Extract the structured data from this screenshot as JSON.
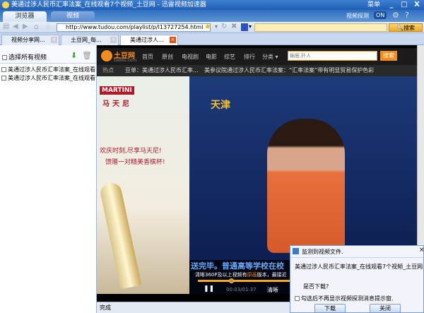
{
  "window": {
    "title": "美通过涉人民币汇率法案_在线观看7个视频_土豆网 - 迅雷视频加速器",
    "menu": "菜单",
    "min": "_",
    "max": "□",
    "close": "X"
  },
  "main_tabs": [
    {
      "label": "浏览器"
    },
    {
      "label": "视频"
    }
  ],
  "detect": {
    "label": "视频探测",
    "toggle": "ON"
  },
  "address": {
    "url": "http://www.tudou.com/playlist/p/l13727254.html",
    "search_button": "搜索",
    "search_value": ""
  },
  "browser_tabs": [
    {
      "label": "视频分享网..."
    },
    {
      "label": "土豆网_每..."
    },
    {
      "label": "美通过涉人..."
    }
  ],
  "left_panel": {
    "select_all": "选择所有视频",
    "items": [
      "美通过涉人民币汇率法案_在线观看7",
      "美通过涉人民币汇率法案_在线观看7"
    ]
  },
  "tudou": {
    "logo": "土豆网",
    "logo_sub": "tudou.com",
    "nav": [
      "首页",
      "原创",
      "电视剧",
      "电影",
      "综艺",
      "排行",
      "分类 ▾"
    ],
    "search_placeholder": "蜗居,扑人",
    "search_button": "搜索",
    "hot_label": "热点",
    "hot_items": [
      "豆单：美通过涉人民币汇率...",
      "美参议院通过涉人民币汇率法案：“汇率法案”带有明显贸易保护色彩"
    ]
  },
  "ad": {
    "brand": "MARTINI",
    "brand_cn": "马天尼",
    "line1": "欢庆时刻,尽享马天尼!",
    "line2": "馈赠一对精美香槟杯!"
  },
  "video": {
    "channel": "天津",
    "caption": "送完毕。普通高等学校在校",
    "notice_pre": "清晰360P及以上视频有",
    "notice_hl": "原画",
    "notice_post": "版本，最接近",
    "time": "00:03/01:37",
    "quality": "清晰",
    "progress": 0.15
  },
  "status": "完成",
  "dialog": {
    "title": "监测到视频文件.",
    "filename": "美通过涉人民币汇率法案_在线观看7个视频_土豆网",
    "question": "是否下载?",
    "checkbox": "勾选后不再显示视频探测消息提示窗.",
    "download": "下载",
    "close": "关闭",
    "x": "×"
  }
}
